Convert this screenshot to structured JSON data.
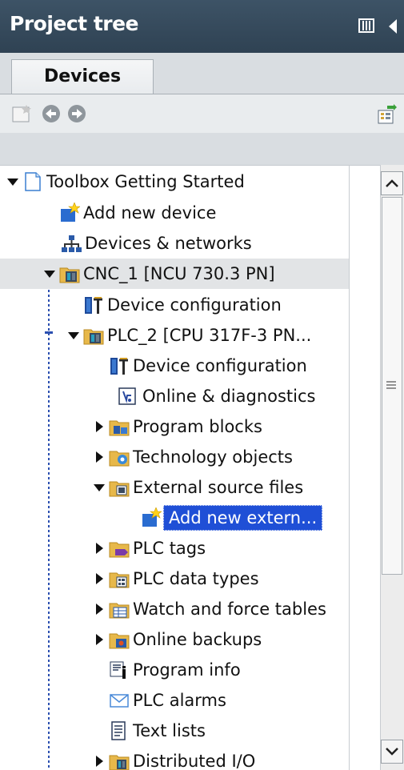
{
  "panel": {
    "title": "Project tree"
  },
  "tabs": [
    {
      "label": "Devices",
      "active": true
    }
  ],
  "toolbar": {
    "icons": [
      "new-folder-icon",
      "back-arrow-icon",
      "forward-arrow-icon",
      "tree-view-options-icon"
    ]
  },
  "tree": {
    "items": [
      {
        "label": "Toolbox Getting Started",
        "icon": "project-icon",
        "expanded": true
      },
      {
        "label": "Add new device",
        "icon": "add-device-icon"
      },
      {
        "label": "Devices & networks",
        "icon": "network-icon"
      },
      {
        "label": "CNC_1 [NCU 730.3 PN]",
        "icon": "cnc-device-icon",
        "expanded": true
      },
      {
        "label": "Device configuration",
        "icon": "device-config-icon"
      },
      {
        "label": "PLC_2 [CPU 317F-3 PN...",
        "icon": "plc-icon",
        "expanded": true
      },
      {
        "label": "Device configuration",
        "icon": "device-config-icon"
      },
      {
        "label": "Online & diagnostics",
        "icon": "diagnostics-icon"
      },
      {
        "label": "Program blocks",
        "icon": "program-blocks-icon",
        "expanded": false
      },
      {
        "label": "Technology objects",
        "icon": "technology-objects-icon",
        "expanded": false
      },
      {
        "label": "External source files",
        "icon": "external-files-icon",
        "expanded": true
      },
      {
        "label": "Add new extern...",
        "icon": "add-new-icon",
        "selected": true
      },
      {
        "label": "PLC tags",
        "icon": "plc-tags-icon",
        "expanded": false
      },
      {
        "label": "PLC data types",
        "icon": "data-types-icon",
        "expanded": false
      },
      {
        "label": "Watch and force tables",
        "icon": "watch-tables-icon",
        "expanded": false
      },
      {
        "label": "Online backups",
        "icon": "backups-icon",
        "expanded": false
      },
      {
        "label": "Program info",
        "icon": "program-info-icon"
      },
      {
        "label": "PLC alarms",
        "icon": "alarms-icon"
      },
      {
        "label": "Text lists",
        "icon": "text-lists-icon"
      },
      {
        "label": "Distributed I/O",
        "icon": "distributed-io-icon",
        "expanded": false
      }
    ]
  },
  "colors": {
    "titlebar": "#2f4253",
    "selection": "#1f4fd6",
    "tree_line": "#2b4fb0"
  }
}
